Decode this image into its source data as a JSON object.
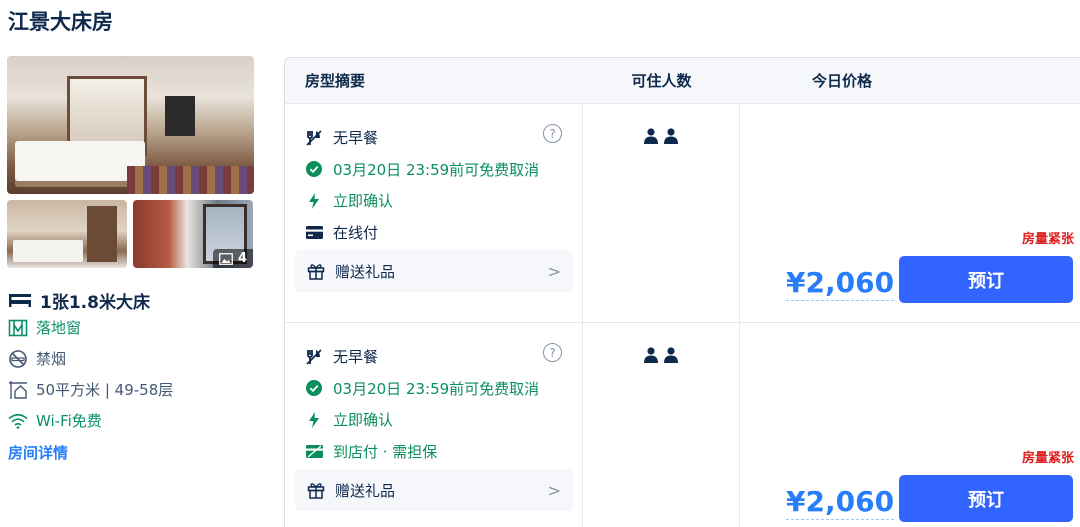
{
  "room": {
    "title": "江景大床房",
    "photo_count": "4",
    "bed": "1张1.8米大床",
    "amenities": [
      {
        "label": "落地窗",
        "icon": "window-icon",
        "tone": "green"
      },
      {
        "label": "禁烟",
        "icon": "no-smoking-icon",
        "tone": "gray"
      },
      {
        "label": "50平方米 | 49-58层",
        "icon": "area-icon",
        "tone": "gray"
      },
      {
        "label": "Wi-Fi免费",
        "icon": "wifi-icon",
        "tone": "green"
      }
    ],
    "detail_link": "房间详情"
  },
  "table": {
    "headers": {
      "summary": "房型摘要",
      "guests": "可住人数",
      "price": "今日价格"
    },
    "rates": [
      {
        "breakfast": "无早餐",
        "cancel": "03月20日 23:59前可免费取消",
        "confirm": "立即确认",
        "payment": "在线付",
        "payment_icon": "card-icon",
        "gift": "赠送礼品",
        "guests": 2,
        "scarcity": "房量紧张",
        "price": "¥2,060",
        "book_label": "预订"
      },
      {
        "breakfast": "无早餐",
        "cancel": "03月20日 23:59前可免费取消",
        "confirm": "立即确认",
        "payment": "到店付 · 需担保",
        "payment_icon": "pay-at-hotel-icon",
        "gift": "赠送礼品",
        "guests": 2,
        "scarcity": "房量紧张",
        "price": "¥2,060",
        "book_label": "预订"
      }
    ]
  },
  "colors": {
    "accent": "#287dfa",
    "button": "#3264ff",
    "green": "#0a8f5b",
    "alert": "#e02020"
  }
}
